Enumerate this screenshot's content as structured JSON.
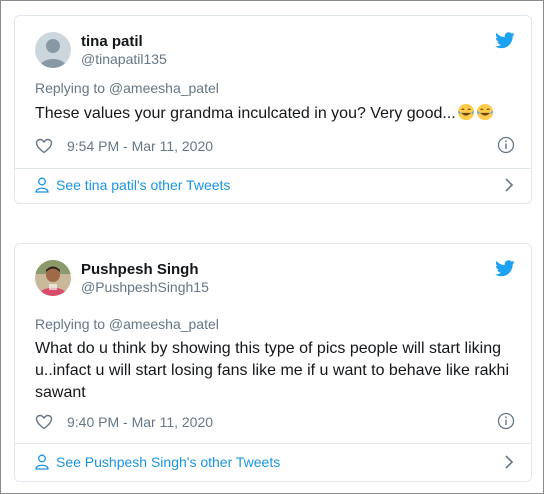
{
  "colors": {
    "link": "#1b95e0",
    "muted": "#657786",
    "text": "#14171a",
    "border": "#e1e8ed"
  },
  "tweets": [
    {
      "name": "tina patil",
      "handle": "@tinapatil135",
      "replying": "Replying to @ameesha_patel",
      "text": "These values your grandma inculcated in you? Very good...",
      "emojis": [
        "face-with-tears-of-joy",
        "face-with-tears-of-joy"
      ],
      "timestamp": "9:54 PM - Mar 11, 2020",
      "footer": "See tina patil's other Tweets"
    },
    {
      "name": "Pushpesh Singh",
      "handle": "@PushpeshSingh15",
      "replying": "Replying to @ameesha_patel",
      "text": "What do u think by showing this type of pics people will start liking u..infact u will start losing fans like me if u want to behave like rakhi sawant",
      "timestamp": "9:40 PM - Mar 11, 2020",
      "footer": "See Pushpesh Singh's other Tweets"
    }
  ]
}
